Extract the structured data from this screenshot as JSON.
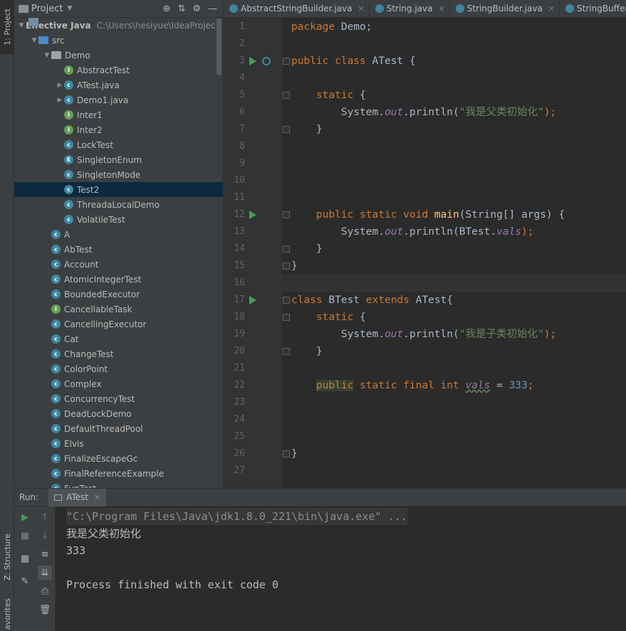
{
  "left_strip": {
    "project_tab": "1: Project",
    "structure_tab": "Z: Structure",
    "favorites_tab": "avorites"
  },
  "project": {
    "title": "Project",
    "tree": [
      {
        "label": "Effective Java",
        "path": "C:\\Users\\hesiyue\\IdeaProjec",
        "icon": "project-icon",
        "indent": 0,
        "expanded": true,
        "bold": true
      },
      {
        "label": "src",
        "icon": "source-folder-icon",
        "indent": 1,
        "expanded": true
      },
      {
        "label": "Demo",
        "icon": "package-icon",
        "indent": 2,
        "expanded": true
      },
      {
        "label": "AbstractTest",
        "icon": "interface-icon",
        "indent": 3
      },
      {
        "label": "ATest.java",
        "icon": "class-icon",
        "indent": 3,
        "collapsed": true
      },
      {
        "label": "Demo1.java",
        "icon": "class-icon",
        "indent": 3,
        "collapsed": true
      },
      {
        "label": "Inter1",
        "icon": "interface-icon",
        "indent": 3
      },
      {
        "label": "Inter2",
        "icon": "interface-icon",
        "indent": 3
      },
      {
        "label": "LockTest",
        "icon": "class-icon",
        "indent": 3
      },
      {
        "label": "SingletonEnum",
        "icon": "enum-icon",
        "indent": 3
      },
      {
        "label": "SingletonMode",
        "icon": "class-icon",
        "indent": 3
      },
      {
        "label": "Test2",
        "icon": "class-icon",
        "indent": 3,
        "selected": true
      },
      {
        "label": "ThreadaLocalDemo",
        "icon": "class-icon",
        "indent": 3
      },
      {
        "label": "VolatileTest",
        "icon": "class-icon",
        "indent": 3
      },
      {
        "label": "A",
        "icon": "class-icon",
        "indent": 2
      },
      {
        "label": "AbTest",
        "icon": "abstract-class-icon",
        "indent": 2
      },
      {
        "label": "Account",
        "icon": "class-icon",
        "indent": 2
      },
      {
        "label": "AtomicIntegerTest",
        "icon": "class-icon",
        "indent": 2
      },
      {
        "label": "BoundedExecutor",
        "icon": "class-icon",
        "indent": 2
      },
      {
        "label": "CancellableTask",
        "icon": "interface-icon",
        "indent": 2
      },
      {
        "label": "CancellingExecutor",
        "icon": "class-icon",
        "indent": 2
      },
      {
        "label": "Cat",
        "icon": "class-icon",
        "indent": 2
      },
      {
        "label": "ChangeTest",
        "icon": "class-icon",
        "indent": 2
      },
      {
        "label": "ColorPoint",
        "icon": "class-icon",
        "indent": 2
      },
      {
        "label": "Complex",
        "icon": "class-icon",
        "indent": 2
      },
      {
        "label": "ConcurrencyTest",
        "icon": "class-icon",
        "indent": 2
      },
      {
        "label": "DeadLockDemo",
        "icon": "class-icon",
        "indent": 2
      },
      {
        "label": "DefaultThreadPool",
        "icon": "class-icon",
        "indent": 2
      },
      {
        "label": "Elvis",
        "icon": "class-icon",
        "indent": 2
      },
      {
        "label": "FinalizeEscapeGc",
        "icon": "class-icon",
        "indent": 2
      },
      {
        "label": "FinalReferenceExample",
        "icon": "class-icon",
        "indent": 2
      },
      {
        "label": "FunTest",
        "icon": "class-icon",
        "indent": 2
      }
    ]
  },
  "editor": {
    "tabs": [
      {
        "label": "AbstractStringBuilder.java"
      },
      {
        "label": "String.java"
      },
      {
        "label": "StringBuilder.java"
      },
      {
        "label": "StringBufferTe"
      }
    ],
    "line_numbers": [
      "1",
      "2",
      "3",
      "4",
      "5",
      "6",
      "7",
      "8",
      "9",
      "10",
      "11",
      "12",
      "13",
      "14",
      "15",
      "16",
      "17",
      "18",
      "19",
      "20",
      "21",
      "22",
      "23",
      "24",
      "25",
      "26",
      "27"
    ],
    "code": [
      [
        {
          "t": "package ",
          "c": "kw"
        },
        {
          "t": "Demo;",
          "c": ""
        }
      ],
      [],
      [
        {
          "t": "public class ",
          "c": "kw"
        },
        {
          "t": "ATest {",
          "c": ""
        }
      ],
      [],
      [
        {
          "t": "    static ",
          "c": "kw"
        },
        {
          "t": "{",
          "c": ""
        }
      ],
      [
        {
          "t": "        System.",
          "c": ""
        },
        {
          "t": "out",
          "c": "fld"
        },
        {
          "t": ".println(",
          "c": ""
        },
        {
          "t": "\"我是父类初始化\"",
          "c": "str"
        },
        {
          "t": ");",
          "c": "kw"
        }
      ],
      [
        {
          "t": "    }",
          "c": ""
        }
      ],
      [],
      [],
      [],
      [],
      [
        {
          "t": "    public static void ",
          "c": "kw"
        },
        {
          "t": "main",
          "c": "fn"
        },
        {
          "t": "(String[] args) {",
          "c": ""
        }
      ],
      [
        {
          "t": "        System.",
          "c": ""
        },
        {
          "t": "out",
          "c": "fld"
        },
        {
          "t": ".println(BTest.",
          "c": ""
        },
        {
          "t": "vals",
          "c": "fld"
        },
        {
          "t": ");",
          "c": "kw"
        }
      ],
      [
        {
          "t": "    }",
          "c": ""
        }
      ],
      [
        {
          "t": "}",
          "c": ""
        }
      ],
      [],
      [
        {
          "t": "class ",
          "c": "kw"
        },
        {
          "t": "BTest ",
          "c": ""
        },
        {
          "t": "extends ",
          "c": "kw"
        },
        {
          "t": "ATest{",
          "c": ""
        }
      ],
      [
        {
          "t": "    static ",
          "c": "kw"
        },
        {
          "t": "{",
          "c": ""
        }
      ],
      [
        {
          "t": "        System.",
          "c": ""
        },
        {
          "t": "out",
          "c": "fld"
        },
        {
          "t": ".println(",
          "c": ""
        },
        {
          "t": "\"我是子类初始化\"",
          "c": "str"
        },
        {
          "t": ");",
          "c": "kw"
        }
      ],
      [
        {
          "t": "    }",
          "c": ""
        }
      ],
      [],
      [
        {
          "t": "    ",
          "c": ""
        },
        {
          "t": "public",
          "c": "kw hl"
        },
        {
          "t": " static final int ",
          "c": "kw"
        },
        {
          "t": "vals",
          "c": "fld wavy"
        },
        {
          "t": " = ",
          "c": ""
        },
        {
          "t": "333",
          "c": "num"
        },
        {
          "t": ";",
          "c": "kw"
        }
      ],
      [],
      [],
      [],
      [
        {
          "t": "}",
          "c": ""
        }
      ],
      []
    ]
  },
  "run": {
    "label": "Run:",
    "tab_label": "ATest",
    "console": [
      {
        "text": "\"C:\\Program Files\\Java\\jdk1.8.0_221\\bin\\java.exe\" ...",
        "kind": "cmd"
      },
      {
        "text": "我是父类初始化",
        "kind": "out"
      },
      {
        "text": "333",
        "kind": "out"
      },
      {
        "text": "",
        "kind": "out"
      },
      {
        "text": "Process finished with exit code 0",
        "kind": "out"
      }
    ]
  },
  "colors": {
    "accent": "#0d293e",
    "run_green": "#499c54",
    "keyword": "#cc7832",
    "string": "#6a8759",
    "number": "#6897bb",
    "field": "#9876aa"
  }
}
